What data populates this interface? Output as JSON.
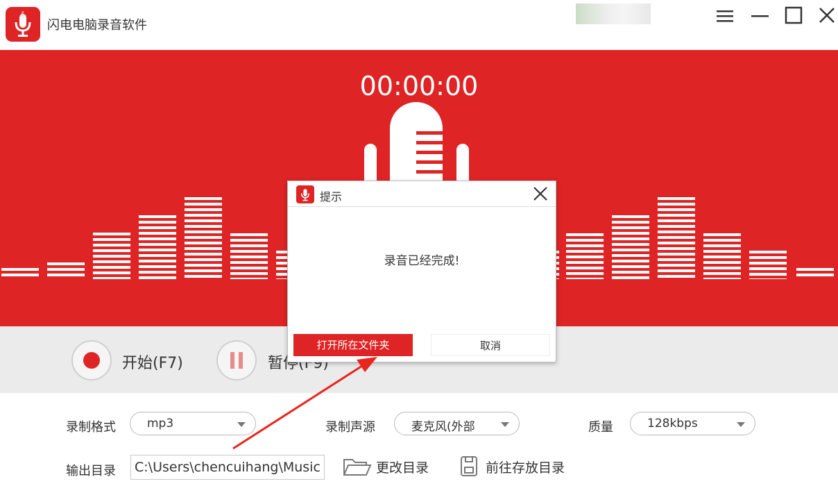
{
  "window": {
    "title": "闪电电脑录音软件",
    "icons": {
      "logo": "microphone-logo-icon",
      "menu": "menu-icon",
      "minimize": "minimize-icon",
      "maximize": "maximize-icon",
      "close": "close-icon"
    }
  },
  "recorder": {
    "timer": "00:00:00",
    "start_label": "开始(F7)",
    "pause_label": "暂停(F9)",
    "accent_color": "#de2424"
  },
  "settings": {
    "format_label": "录制格式",
    "format_value": "mp3",
    "source_label": "录制声源",
    "source_value": "麦克风(外部",
    "quality_label": "质量",
    "quality_value": "128kbps",
    "output_label": "输出目录",
    "output_path": "C:\\Users\\chencuihang\\Music",
    "change_dir_label": "更改目录",
    "open_dir_label": "前往存放目录"
  },
  "dialog": {
    "title": "提示",
    "message": "录音已经完成!",
    "open_folder_label": "打开所在文件夹",
    "cancel_label": "取消"
  },
  "annotation": {
    "arrow_color": "#e8261d"
  }
}
